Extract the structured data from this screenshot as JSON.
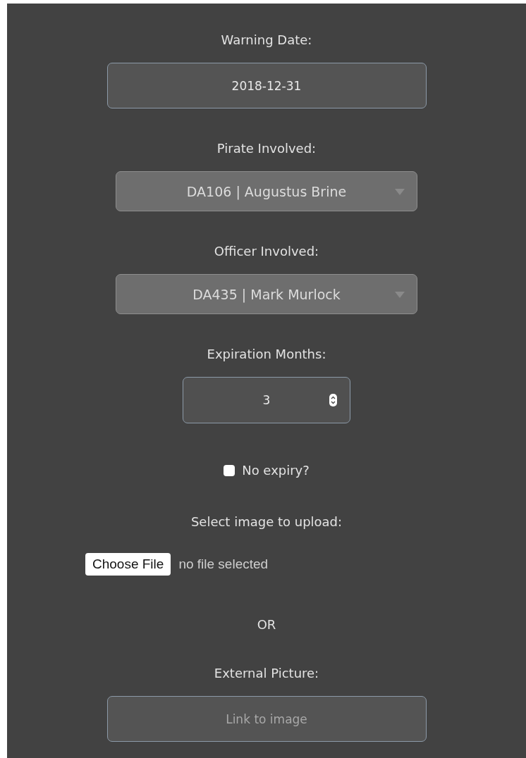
{
  "fields": [
    {
      "kind": "text",
      "label": "Warning Date:",
      "value": "2018-12-31"
    },
    {
      "kind": "select",
      "label": "Pirate Involved:",
      "value": "DA106 | Augustus Brine"
    },
    {
      "kind": "select",
      "label": "Officer Involved:",
      "value": "DA435 | Mark Murlock"
    },
    {
      "kind": "number",
      "label": "Expiration Months:",
      "value": "3"
    },
    {
      "kind": "checkbox",
      "label": "No expiry?",
      "checked": false
    },
    {
      "kind": "file",
      "label": "Select image to upload:",
      "button": "Choose File",
      "status": "no file selected"
    },
    {
      "kind": "separator",
      "text": "OR"
    },
    {
      "kind": "text",
      "label": "External Picture:",
      "placeholder": "Link to image"
    }
  ]
}
